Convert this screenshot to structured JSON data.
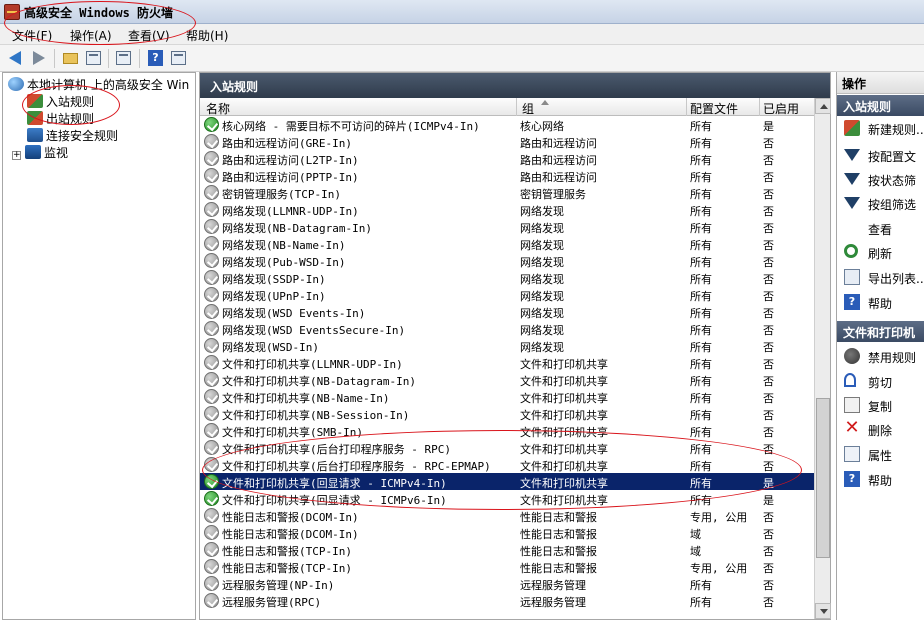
{
  "window": {
    "title": "高级安全 Windows 防火墙"
  },
  "menu": [
    "文件(F)",
    "操作(A)",
    "查看(V)",
    "帮助(H)"
  ],
  "tree": {
    "root": "本地计算机 上的高级安全 Win",
    "items": [
      "入站规则",
      "出站规则",
      "连接安全规则",
      "监视"
    ]
  },
  "center": {
    "header": "入站规则",
    "columns": [
      "名称",
      "组",
      "配置文件",
      "已启用"
    ],
    "rows": [
      {
        "name": "核心网络 - 需要目标不可访问的碎片(ICMPv4-In)",
        "group": "核心网络",
        "profile": "所有",
        "enabled": "是",
        "state": "enabled"
      },
      {
        "name": "路由和远程访问(GRE-In)",
        "group": "路由和远程访问",
        "profile": "所有",
        "enabled": "否",
        "state": "disabled"
      },
      {
        "name": "路由和远程访问(L2TP-In)",
        "group": "路由和远程访问",
        "profile": "所有",
        "enabled": "否",
        "state": "disabled"
      },
      {
        "name": "路由和远程访问(PPTP-In)",
        "group": "路由和远程访问",
        "profile": "所有",
        "enabled": "否",
        "state": "disabled"
      },
      {
        "name": "密钥管理服务(TCP-In)",
        "group": "密钥管理服务",
        "profile": "所有",
        "enabled": "否",
        "state": "disabled"
      },
      {
        "name": "网络发现(LLMNR-UDP-In)",
        "group": "网络发现",
        "profile": "所有",
        "enabled": "否",
        "state": "disabled"
      },
      {
        "name": "网络发现(NB-Datagram-In)",
        "group": "网络发现",
        "profile": "所有",
        "enabled": "否",
        "state": "disabled"
      },
      {
        "name": "网络发现(NB-Name-In)",
        "group": "网络发现",
        "profile": "所有",
        "enabled": "否",
        "state": "disabled"
      },
      {
        "name": "网络发现(Pub-WSD-In)",
        "group": "网络发现",
        "profile": "所有",
        "enabled": "否",
        "state": "disabled"
      },
      {
        "name": "网络发现(SSDP-In)",
        "group": "网络发现",
        "profile": "所有",
        "enabled": "否",
        "state": "disabled"
      },
      {
        "name": "网络发现(UPnP-In)",
        "group": "网络发现",
        "profile": "所有",
        "enabled": "否",
        "state": "disabled"
      },
      {
        "name": "网络发现(WSD Events-In)",
        "group": "网络发现",
        "profile": "所有",
        "enabled": "否",
        "state": "disabled"
      },
      {
        "name": "网络发现(WSD EventsSecure-In)",
        "group": "网络发现",
        "profile": "所有",
        "enabled": "否",
        "state": "disabled"
      },
      {
        "name": "网络发现(WSD-In)",
        "group": "网络发现",
        "profile": "所有",
        "enabled": "否",
        "state": "disabled"
      },
      {
        "name": "文件和打印机共享(LLMNR-UDP-In)",
        "group": "文件和打印机共享",
        "profile": "所有",
        "enabled": "否",
        "state": "disabled"
      },
      {
        "name": "文件和打印机共享(NB-Datagram-In)",
        "group": "文件和打印机共享",
        "profile": "所有",
        "enabled": "否",
        "state": "disabled"
      },
      {
        "name": "文件和打印机共享(NB-Name-In)",
        "group": "文件和打印机共享",
        "profile": "所有",
        "enabled": "否",
        "state": "disabled"
      },
      {
        "name": "文件和打印机共享(NB-Session-In)",
        "group": "文件和打印机共享",
        "profile": "所有",
        "enabled": "否",
        "state": "disabled"
      },
      {
        "name": "文件和打印机共享(SMB-In)",
        "group": "文件和打印机共享",
        "profile": "所有",
        "enabled": "否",
        "state": "disabled"
      },
      {
        "name": "文件和打印机共享(后台打印程序服务 - RPC)",
        "group": "文件和打印机共享",
        "profile": "所有",
        "enabled": "否",
        "state": "disabled"
      },
      {
        "name": "文件和打印机共享(后台打印程序服务 - RPC-EPMAP)",
        "group": "文件和打印机共享",
        "profile": "所有",
        "enabled": "否",
        "state": "disabled"
      },
      {
        "name": "文件和打印机共享(回显请求 - ICMPv4-In)",
        "group": "文件和打印机共享",
        "profile": "所有",
        "enabled": "是",
        "state": "enabled",
        "selected": true
      },
      {
        "name": "文件和打印机共享(回显请求 - ICMPv6-In)",
        "group": "文件和打印机共享",
        "profile": "所有",
        "enabled": "是",
        "state": "enabled"
      },
      {
        "name": "性能日志和警报(DCOM-In)",
        "group": "性能日志和警报",
        "profile": "专用, 公用",
        "enabled": "否",
        "state": "disabled"
      },
      {
        "name": "性能日志和警报(DCOM-In)",
        "group": "性能日志和警报",
        "profile": "域",
        "enabled": "否",
        "state": "disabled"
      },
      {
        "name": "性能日志和警报(TCP-In)",
        "group": "性能日志和警报",
        "profile": "域",
        "enabled": "否",
        "state": "disabled"
      },
      {
        "name": "性能日志和警报(TCP-In)",
        "group": "性能日志和警报",
        "profile": "专用, 公用",
        "enabled": "否",
        "state": "disabled"
      },
      {
        "name": "远程服务管理(NP-In)",
        "group": "远程服务管理",
        "profile": "所有",
        "enabled": "否",
        "state": "disabled"
      },
      {
        "name": "远程服务管理(RPC)",
        "group": "远程服务管理",
        "profile": "所有",
        "enabled": "否",
        "state": "disabled"
      }
    ]
  },
  "actions": {
    "header": "操作",
    "section1": "入站规则",
    "items1": [
      "新建规则...",
      "按配置文",
      "按状态筛",
      "按组筛选",
      "查看",
      "刷新",
      "导出列表...",
      "帮助"
    ],
    "section2": "文件和打印机",
    "items2": [
      "禁用规则",
      "剪切",
      "复制",
      "删除",
      "属性",
      "帮助"
    ]
  },
  "colors": {
    "selection": "#0a246a",
    "header_bg": "#3b4a5e",
    "annotation": "#d9141b"
  }
}
